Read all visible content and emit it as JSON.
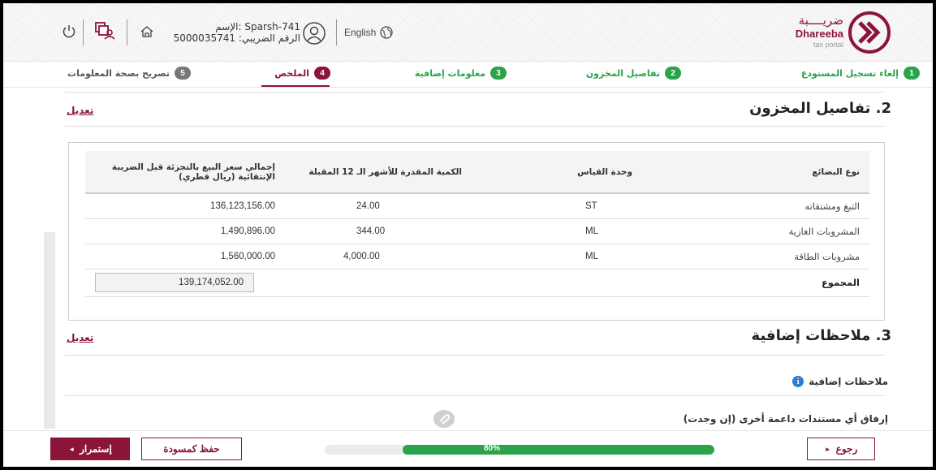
{
  "header": {
    "logo_ar": "ضريــــبة",
    "logo_en": "Dhareeba",
    "logo_sub": "tax portal",
    "language": "English",
    "user_name": "الإسم: Sparsh-741",
    "user_tax_id": "الرقم الضريبي: 5000035741"
  },
  "steps": [
    {
      "num": "1",
      "label": "إلغاء تسجيل المستودع",
      "state": "done"
    },
    {
      "num": "2",
      "label": "تفاصيل المخزون",
      "state": "done"
    },
    {
      "num": "3",
      "label": "معلومات إضافية",
      "state": "done"
    },
    {
      "num": "4",
      "label": "الملخص",
      "state": "active"
    },
    {
      "num": "5",
      "label": "تصريح بصحة المعلومات",
      "state": "pending"
    }
  ],
  "section2": {
    "title": "2. تفاصيل المخزون",
    "edit": "تعديل",
    "columns": {
      "type": "نوع البضائع",
      "unit": "وحدة القياس",
      "qty": "الكمية المقدرة للأشهر الـ 12 المقبلة",
      "total": "إجمالي سعر البيع بالتجزئة قبل الضريبة الإنتقائية (ريال قطري)"
    },
    "rows": [
      {
        "type": "التبغ ومشتقاته",
        "unit": "ST",
        "qty": "24.00",
        "total": "136,123,156.00"
      },
      {
        "type": "المشروبات الغازية",
        "unit": "ML",
        "qty": "344.00",
        "total": "1,490,896.00"
      },
      {
        "type": "مشروبات الطاقة",
        "unit": "ML",
        "qty": "4,000.00",
        "total": "1,560,000.00"
      }
    ],
    "sum_label": "المجموع",
    "sum_value": "139,174,052.00"
  },
  "section3": {
    "title": "3. ملاحظات إضافية",
    "edit": "تعديل",
    "notes_label": "ملاحظات إضافية",
    "attach_label": "إرفاق أي مستندات داعمة أخرى (إن وجدت)"
  },
  "footer": {
    "continue": "إستمرار",
    "save_draft": "حفظ كمسودة",
    "back": "رجوع",
    "progress_label": "80%",
    "progress": 0.8
  },
  "colors": {
    "brand": "#8a1538",
    "success": "#2aa34a",
    "info": "#2b7fd1"
  }
}
